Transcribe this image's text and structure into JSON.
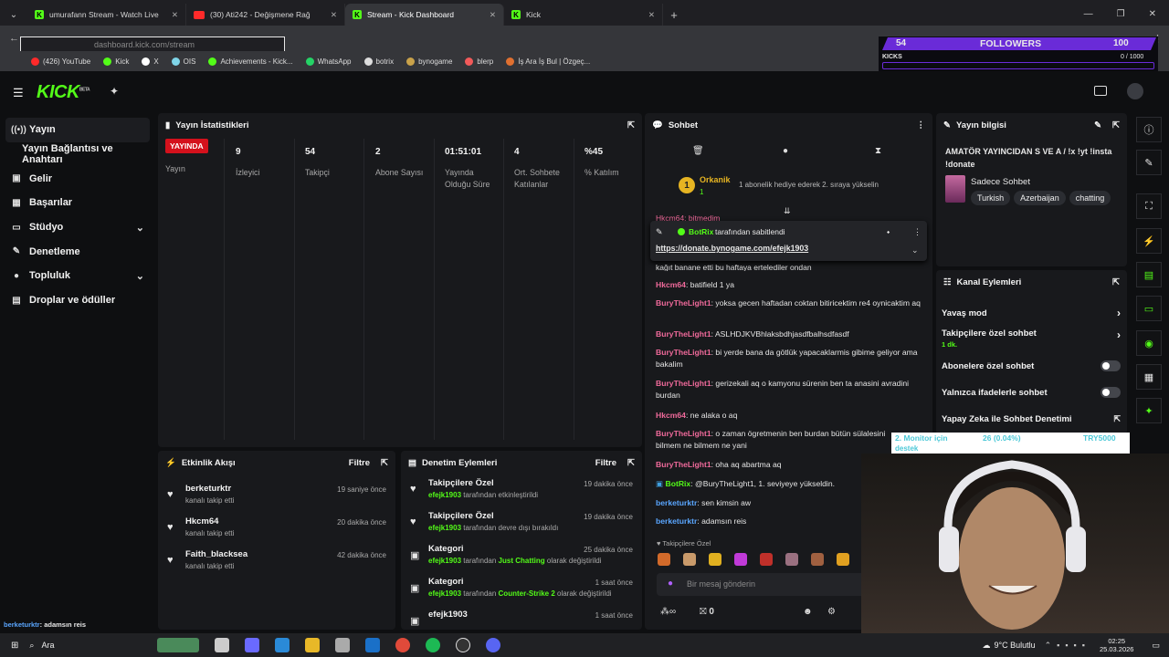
{
  "browser": {
    "tabs": [
      {
        "title": "umurafann Stream - Watch Live",
        "fav": "kick"
      },
      {
        "title": "(30) Ati242 - Değişmene Rağ",
        "fav": "youtube"
      },
      {
        "title": "Stream - Kick Dashboard",
        "fav": "kick",
        "active": true
      },
      {
        "title": "Kick",
        "fav": "kick"
      }
    ],
    "new_tab": "+",
    "url": "dashboard.kick.com/stream",
    "bookmarks": [
      "(426) YouTube",
      "Kick",
      "X",
      "OIS",
      "Achievements - Kick...",
      "WhatsApp",
      "botrix",
      "bynogame",
      "blerp",
      "İş Ara İş Bul | Özgeç..."
    ]
  },
  "overlay": {
    "followers_count": "54",
    "followers_label": "FOLLOWERS",
    "followers_goal": "100",
    "kicks_label": "KICKS",
    "kicks_value": "0 / 1000",
    "ticker_a": "2. Monitor için",
    "ticker_b": "26 (0.04%)",
    "ticker_c": "TRY5000",
    "ticker_d": "destek"
  },
  "kick": {
    "logo": "KICK",
    "logo_tag": "BETA"
  },
  "sidebar": {
    "items": [
      {
        "label": "Yayın",
        "icon": "broadcast-icon"
      },
      {
        "label": "Yayın Bağlantısı ve Anahtarı",
        "icon": ""
      },
      {
        "label": "Gelir",
        "icon": "wallet-icon"
      },
      {
        "label": "Başarılar",
        "icon": "grid-icon"
      },
      {
        "label": "Stüdyo",
        "icon": "studio-icon"
      },
      {
        "label": "Denetleme",
        "icon": "wrench-icon"
      },
      {
        "label": "Topluluk",
        "icon": "user-icon"
      },
      {
        "label": "Droplar ve ödüller",
        "icon": "gift-icon"
      }
    ]
  },
  "stats": {
    "title": "Yayın İstatistikleri",
    "live_badge": "YAYINDA",
    "live_label": "Yayın",
    "items": [
      {
        "value": "9",
        "label": "İzleyici"
      },
      {
        "value": "54",
        "label": "Takipçi"
      },
      {
        "value": "2",
        "label": "Abone Sayısı"
      },
      {
        "value": "01:51:01",
        "label": "Yayında Olduğu Süre"
      },
      {
        "value": "4",
        "label": "Ort. Sohbete Katılanlar"
      },
      {
        "value": "%45",
        "label": "% Katılım"
      }
    ]
  },
  "activity": {
    "title": "Etkinlik Akışı",
    "filter": "Filtre",
    "rows": [
      {
        "name": "berketurktr",
        "sub": "kanalı takip etti",
        "time": "19 saniye önce"
      },
      {
        "name": "Hkcm64",
        "sub": "kanalı takip etti",
        "time": "20 dakika önce"
      },
      {
        "name": "Faith_blacksea",
        "sub": "kanalı takip etti",
        "time": "42 dakika önce"
      }
    ]
  },
  "moderation": {
    "title": "Denetim Eylemleri",
    "filter": "Filtre",
    "rows": [
      {
        "name": "Takipçilere Özel",
        "user": "efejk1903",
        "pre": "tarafından etkinleştirildi",
        "hl": "",
        "post": "",
        "time": "19 dakika önce"
      },
      {
        "name": "Takipçilere Özel",
        "user": "efejk1903",
        "pre": "tarafından devre dışı bırakıldı",
        "hl": "",
        "post": "",
        "time": "19 dakika önce"
      },
      {
        "name": "Kategori",
        "user": "efejk1903",
        "pre": "tarafından",
        "hl": "Just Chatting",
        "post": "olarak değiştirildi",
        "time": "25 dakika önce"
      },
      {
        "name": "Kategori",
        "user": "efejk1903",
        "pre": "tarafından",
        "hl": "Counter-Strike 2",
        "post": "olarak değiştirildi",
        "time": "1 saat önce"
      },
      {
        "name": "efejk1903",
        "user": "",
        "pre": "",
        "hl": "",
        "post": "",
        "time": "1 saat önce"
      }
    ]
  },
  "chat": {
    "title": "Sohbet",
    "leader_rank": "1",
    "leader_name": "Orkanik",
    "leader_count": "1",
    "leader_note": "1 abonelik hediye ederek 2. sıraya yükselin",
    "pinned_by_name": "BotRix",
    "pinned_by_text": "tarafından sabitlendi",
    "pinned_link": "https://donate.bynogame.com/efejk1903",
    "partial_top": "Hkcm64: bitmedim",
    "partial_mid": "kağıt banane etti bu haftaya ertelediler ondan",
    "messages": [
      {
        "user": "Hkcm64",
        "color": "pink",
        "text": "batifield 1 ya"
      },
      {
        "user": "BuryTheLight1",
        "color": "pink",
        "text": "yoksa gecen haftadan coktan bitiricektim re4 oynicaktim aq"
      },
      {
        "user": "BuryTheLight1",
        "color": "pink",
        "text": "ASLHDJKVBhlaksbdhjasdfbalhsdfasdf"
      },
      {
        "user": "BuryTheLight1",
        "color": "pink",
        "text": "bi yerde bana da götlük yapacaklarmis gibime geliyor ama bakalim"
      },
      {
        "user": "BuryTheLight1",
        "color": "pink",
        "text": "gerizekali aq o kamyonu sürenin ben ta anasini avradini burdan"
      },
      {
        "user": "Hkcm64",
        "color": "pink",
        "text": "ne alaka o aq"
      },
      {
        "user": "BuryTheLight1",
        "color": "pink",
        "text": "o zaman ögretmenin ben burdan bütün sülalesini bilmem ne bilmem ne yani"
      },
      {
        "user": "BuryTheLight1",
        "color": "pink",
        "text": "oha aq abartma aq"
      },
      {
        "user": "BotRix",
        "color": "bot",
        "text": "@BuryTheLight1, 1. seviyeye yükseldin."
      },
      {
        "user": "berketurktr",
        "color": "blue",
        "text": "sen kimsin aw"
      },
      {
        "user": "berketurktr",
        "color": "blue",
        "text": "adamsın reis"
      }
    ],
    "mode_label": "Takipçilere Özel",
    "input_placeholder": "Bir mesaj gönderin",
    "viewers_icon_text": "∞",
    "points": "0"
  },
  "stream_info": {
    "title": "Yayın bilgisi",
    "stream_title": "AMATÖR YAYINCIDAN S VE A / !x !yt !insta !donate",
    "category": "Sadece Sohbet",
    "tags": [
      "Turkish",
      "Azerbaijan",
      "chatting"
    ]
  },
  "channel_actions": {
    "title": "Kanal Eylemleri",
    "rows": [
      {
        "label": "Yavaş mod",
        "sub": "",
        "ctrl": "arrow"
      },
      {
        "label": "Takipçilere özel sohbet",
        "sub": "1 dk.",
        "ctrl": "arrow"
      },
      {
        "label": "Abonelere özel sohbet",
        "sub": "",
        "ctrl": "toggle"
      },
      {
        "label": "Yalnızca ifadelerle sohbet",
        "sub": "",
        "ctrl": "toggle"
      },
      {
        "label": "Yapay Zeka ile Sohbet Denetimi",
        "sub": "",
        "ctrl": "link"
      }
    ]
  },
  "toast": {
    "user": "berketurktr",
    "text": ": adamsın reis"
  },
  "taskbar": {
    "search": "Ara",
    "weather": "9°C  Bulutlu",
    "time": "02:25",
    "date": "25.03.2026"
  },
  "colors": {
    "kick_green": "#53fc18",
    "live_red": "#d4111c",
    "purple": "#6a2bd8"
  }
}
